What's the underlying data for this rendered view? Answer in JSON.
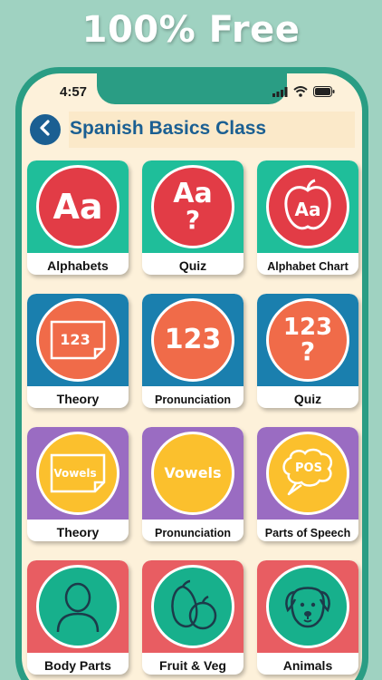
{
  "banner": "100% Free",
  "status": {
    "time": "4:57"
  },
  "header": {
    "title": "Spanish Basics Class"
  },
  "colors": {
    "teal": "#1fbe9a",
    "blue": "#1a7fae",
    "purple": "#9a6cc2",
    "red": "#e85d62",
    "circle_red": "#e23c46",
    "circle_orange": "#f06b49",
    "circle_yellow": "#fbc02d",
    "circle_teal": "#17b08c"
  },
  "tiles": [
    {
      "label": "Alphabets",
      "icon": "aa-icon",
      "glyph": "Aa"
    },
    {
      "label": "Quiz",
      "icon": "aa-question-icon",
      "glyph": "Aa",
      "glyph2": "?"
    },
    {
      "label": "Alphabet Chart",
      "icon": "apple-aa-icon",
      "glyph": "Aa"
    },
    {
      "label": "Theory",
      "icon": "number-card-icon",
      "glyph": "123"
    },
    {
      "label": "Pronunciation",
      "icon": "numbers-icon",
      "glyph": "123"
    },
    {
      "label": "Quiz",
      "icon": "numbers-question-icon",
      "glyph": "123",
      "glyph2": "?"
    },
    {
      "label": "Theory",
      "icon": "vowels-card-icon",
      "glyph": "Vowels"
    },
    {
      "label": "Pronunciation",
      "icon": "vowels-icon",
      "glyph": "Vowels"
    },
    {
      "label": "Parts of Speech",
      "icon": "speech-bubble-icon",
      "glyph": "POS"
    },
    {
      "label": "Body Parts",
      "icon": "person-icon"
    },
    {
      "label": "Fruit & Veg",
      "icon": "fruit-icon"
    },
    {
      "label": "Animals",
      "icon": "dog-icon"
    }
  ]
}
